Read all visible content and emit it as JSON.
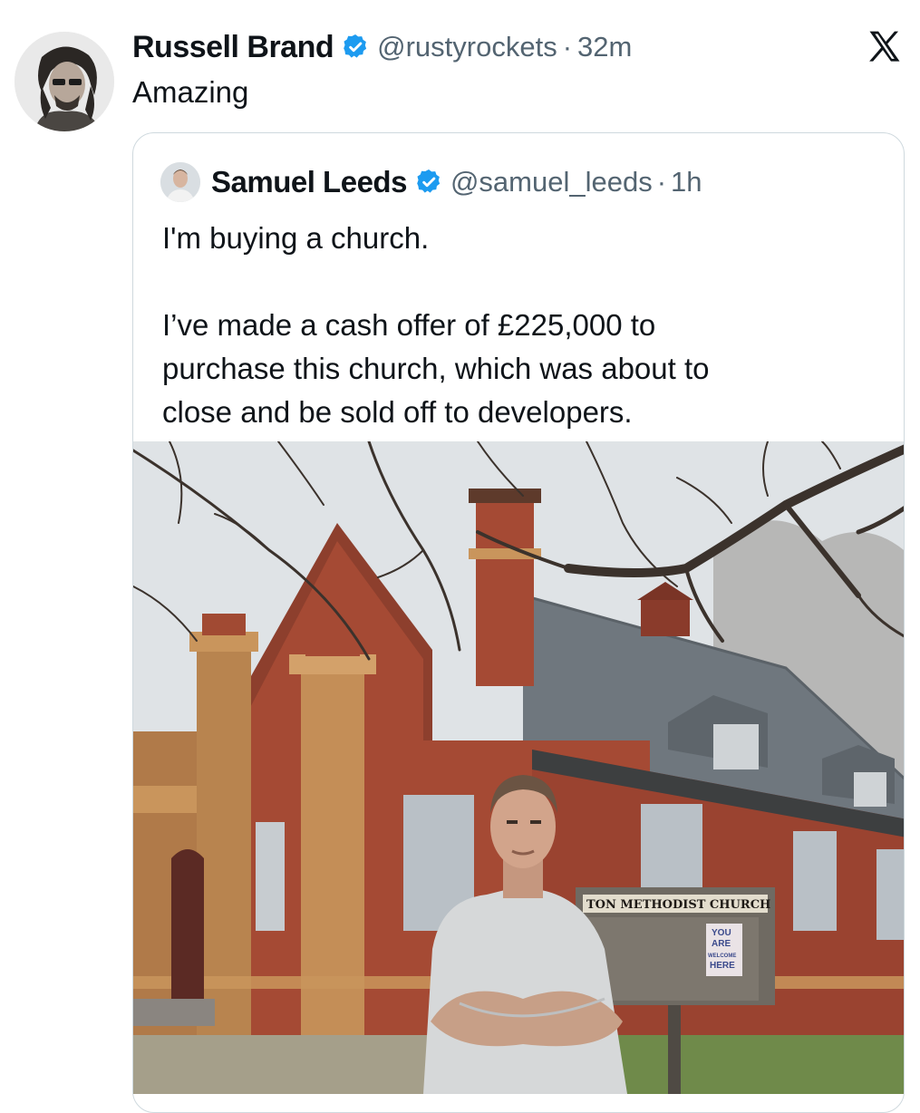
{
  "tweet": {
    "author": {
      "display_name": "Russell Brand",
      "handle": "@rustyrockets",
      "avatar_icon": "profile-photo",
      "verified_icon": "verified-badge-icon"
    },
    "separator": "·",
    "time": "32m",
    "text": "Amazing",
    "platform_icon": "x-logo-icon"
  },
  "quote": {
    "author": {
      "display_name": "Samuel Leeds",
      "handle": "@samuel_leeds",
      "avatar_icon": "profile-photo",
      "verified_icon": "verified-badge-icon"
    },
    "separator": "·",
    "time": "1h",
    "text_lines": [
      "I'm buying a church.",
      "I’ve made a cash offer of £225,000 to",
      "purchase this church, which was about to",
      "close and be sold off to developers."
    ],
    "media": {
      "sign_text": "TON METHODIST CHURCH",
      "poster_lines": [
        "YOU",
        "ARE",
        "WELCOME",
        "HERE"
      ]
    }
  },
  "colors": {
    "text_primary": "#0f1419",
    "text_secondary": "#536471",
    "verified_blue": "#1d9bf0",
    "border": "#cfd9de",
    "brick": "#a54a34",
    "sandstone": "#c9955c",
    "roof": "#6f777e"
  }
}
